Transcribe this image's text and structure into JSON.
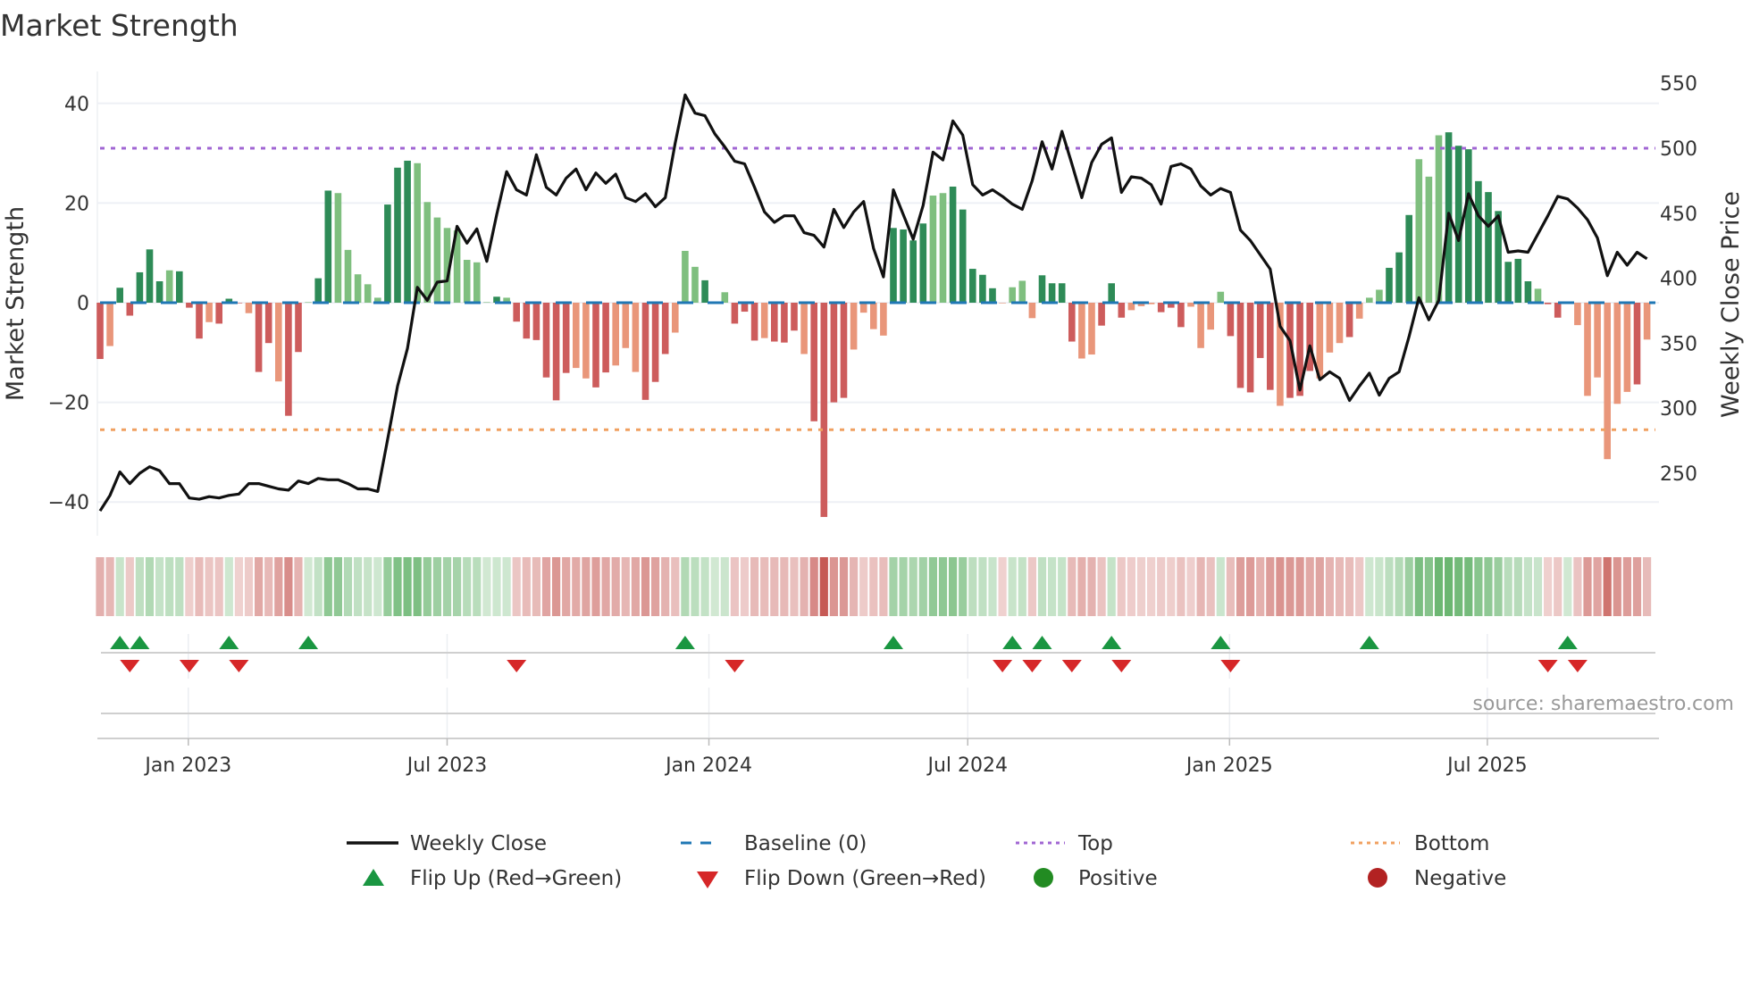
{
  "chart_data": {
    "type": "bar",
    "title": "Market Strength",
    "ylabel": "Market Strength",
    "y2label": "Weekly Close Price",
    "ylim": [
      -44,
      44
    ],
    "y2lim": [
      215,
      560
    ],
    "yticks": [
      {
        "v": 40,
        "label": "40"
      },
      {
        "v": 20,
        "label": "20"
      },
      {
        "v": 0,
        "label": "0"
      },
      {
        "v": -20,
        "label": "−20"
      },
      {
        "v": -40,
        "label": "−40"
      }
    ],
    "y2ticks": [
      {
        "v": 550,
        "label": "550"
      },
      {
        "v": 500,
        "label": "500"
      },
      {
        "v": 450,
        "label": "450"
      },
      {
        "v": 400,
        "label": "400"
      },
      {
        "v": 350,
        "label": "350"
      },
      {
        "v": 300,
        "label": "300"
      },
      {
        "v": 250,
        "label": "250"
      }
    ],
    "xticks": [
      {
        "week": 9.9,
        "label": "Jan 2023"
      },
      {
        "week": 36.0,
        "label": "Jul 2023"
      },
      {
        "week": 62.4,
        "label": "Jan 2024"
      },
      {
        "week": 88.5,
        "label": "Jul 2024"
      },
      {
        "week": 114.9,
        "label": "Jan 2025"
      },
      {
        "week": 140.9,
        "label": "Jul 2025"
      }
    ],
    "grid": true,
    "top_threshold": 31,
    "bottom_threshold": -25.5,
    "baseline": 0,
    "strength": [
      -11.3,
      -8.7,
      3.0,
      -2.6,
      6.1,
      10.7,
      4.3,
      6.5,
      6.3,
      -1.0,
      -7.2,
      -3.9,
      -4.2,
      0.8,
      -0.1,
      -2.1,
      -13.9,
      -8.1,
      -15.8,
      -22.7,
      -9.9,
      0.1,
      4.9,
      22.5,
      22.0,
      10.6,
      5.7,
      3.7,
      1.0,
      19.7,
      27.1,
      28.5,
      28.0,
      20.2,
      17.1,
      15.0,
      14.5,
      8.6,
      8.1,
      0.1,
      1.2,
      1.0,
      -3.8,
      -7.2,
      -7.5,
      -15.0,
      -19.6,
      -14.1,
      -13.1,
      -15.2,
      -17.0,
      -14.0,
      -12.6,
      -9.1,
      -13.9,
      -19.5,
      -15.9,
      -10.3,
      -6.0,
      10.4,
      7.2,
      4.5,
      0.1,
      2.1,
      -4.2,
      -1.8,
      -7.6,
      -7.1,
      -7.8,
      -8.0,
      -5.6,
      -10.3,
      -23.8,
      -43.0,
      -20.0,
      -19.1,
      -9.4,
      -2.0,
      -5.3,
      -6.6,
      15.0,
      14.7,
      12.5,
      15.9,
      21.5,
      22.0,
      23.3,
      18.7,
      6.8,
      5.6,
      2.9,
      -0.1,
      3.1,
      4.4,
      -3.1,
      5.5,
      3.9,
      3.9,
      -7.8,
      -11.2,
      -10.4,
      -4.6,
      3.9,
      -3.0,
      -1.5,
      -0.7,
      -0.3,
      -1.9,
      -1.0,
      -4.9,
      -0.8,
      -9.1,
      -5.4,
      2.2,
      -6.7,
      -17.1,
      -18.0,
      -11.1,
      -17.5,
      -20.7,
      -19.1,
      -18.7,
      -13.7,
      -15.2,
      -10.0,
      -8.1,
      -6.9,
      -3.2,
      1.0,
      2.6,
      7.0,
      10.1,
      17.6,
      28.8,
      25.3,
      33.6,
      34.2,
      31.5,
      30.8,
      24.4,
      22.2,
      18.4,
      8.2,
      8.8,
      4.3,
      2.8,
      -0.3,
      -3.0,
      0.2,
      -4.5,
      -18.7,
      -15.0,
      -31.4,
      -20.3,
      -17.9,
      -16.4,
      -7.4
    ],
    "shade": "dldddddldddldddlddlddlddllllldddlllllllldlddddddllddllldddllldlldddldddlddddllllddddlldddddllllddddlldddllldddlllldddddldddllldllldddllldddddddddlddllllllldlldddddllll",
    "weekly_close": [
      221,
      233,
      251,
      242,
      250,
      255,
      252,
      242,
      242,
      231,
      230,
      232,
      231,
      233,
      234,
      242,
      242,
      240,
      238,
      237,
      244,
      242,
      246,
      245,
      245,
      242,
      238,
      238,
      236,
      276,
      317,
      346,
      393,
      383,
      397,
      398,
      440,
      427,
      438,
      413,
      449,
      482,
      468,
      464,
      495,
      470,
      464,
      477,
      484,
      468,
      481,
      473,
      480,
      462,
      459,
      465,
      455,
      462,
      504,
      541,
      527,
      525,
      511,
      501,
      490,
      488,
      470,
      451,
      443,
      448,
      448,
      435,
      433,
      424,
      453,
      439,
      451,
      459,
      423,
      401,
      468,
      449,
      430,
      456,
      497,
      491,
      521,
      510,
      472,
      464,
      468,
      463,
      457,
      453,
      475,
      505,
      484,
      513,
      488,
      462,
      489,
      503,
      508,
      466,
      478,
      477,
      472,
      457,
      486,
      488,
      484,
      471,
      464,
      469,
      466,
      437,
      429,
      418,
      407,
      363,
      352,
      314,
      348,
      322,
      328,
      323,
      306,
      317,
      327,
      310,
      323,
      328,
      355,
      385,
      368,
      383,
      450,
      429,
      465,
      448,
      440,
      448,
      420,
      421,
      420,
      434,
      448,
      463,
      461,
      454,
      445,
      431,
      402,
      420,
      410,
      420,
      415
    ],
    "flip_up_weeks": [
      3,
      5,
      14,
      22,
      60,
      81,
      93,
      96,
      103,
      114,
      129,
      149
    ],
    "flip_down_weeks": [
      4,
      10,
      15,
      43,
      65,
      92,
      95,
      99,
      104,
      115,
      147,
      150
    ],
    "legend_placement": "bottom",
    "legend": [
      {
        "label": "Weekly Close",
        "color": "#111111"
      },
      {
        "label": "Baseline (0)",
        "color": "#1f77b4"
      },
      {
        "label": "Top",
        "color": "#a066d3"
      },
      {
        "label": "Bottom",
        "color": "#f0a060"
      },
      {
        "label": "Flip Up (Red→Green)",
        "color": "#1a9641"
      },
      {
        "label": "Flip Down (Green→Red)",
        "color": "#d62728"
      },
      {
        "label": "Positive",
        "color": "#228b22"
      },
      {
        "label": "Negative",
        "color": "#b22222"
      }
    ],
    "colors": {
      "green_dark": "#2e8b57",
      "green_light": "#7fbf7f",
      "red_dark": "#cd5c5c",
      "red_light": "#e9967a",
      "heat_pos": "#5aae61",
      "heat_neg": "#c65a55"
    },
    "source": "source: sharemaestro.com"
  }
}
